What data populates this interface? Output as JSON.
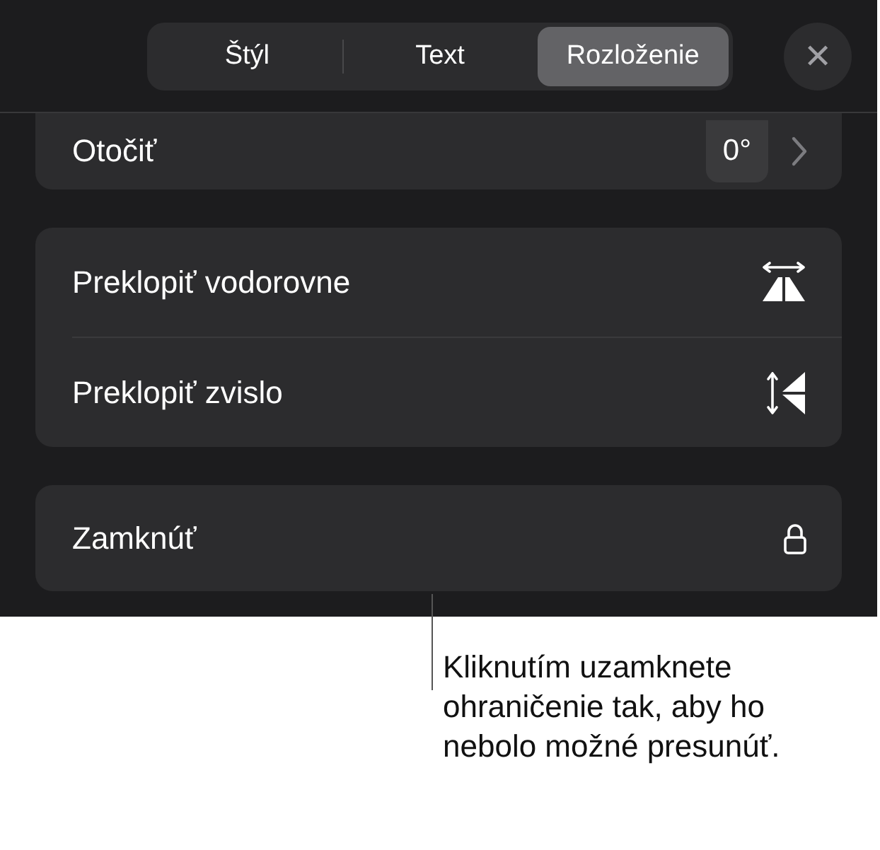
{
  "tabs": [
    {
      "label": "Štýl",
      "selected": false
    },
    {
      "label": "Text",
      "selected": false
    },
    {
      "label": "Rozloženie",
      "selected": true
    }
  ],
  "close_button": {
    "label": "✕"
  },
  "rotate": {
    "label": "Otočiť",
    "value": "0°"
  },
  "flip_rows": [
    {
      "label": "Preklopiť vodorovne",
      "kind": "horizontal"
    },
    {
      "label": "Preklopiť zvislo",
      "kind": "vertical"
    }
  ],
  "lock": {
    "label": "Zamknúť"
  },
  "callout": "Kliknutím uzamknete ohraničenie tak, aby ho nebolo možné presunúť."
}
